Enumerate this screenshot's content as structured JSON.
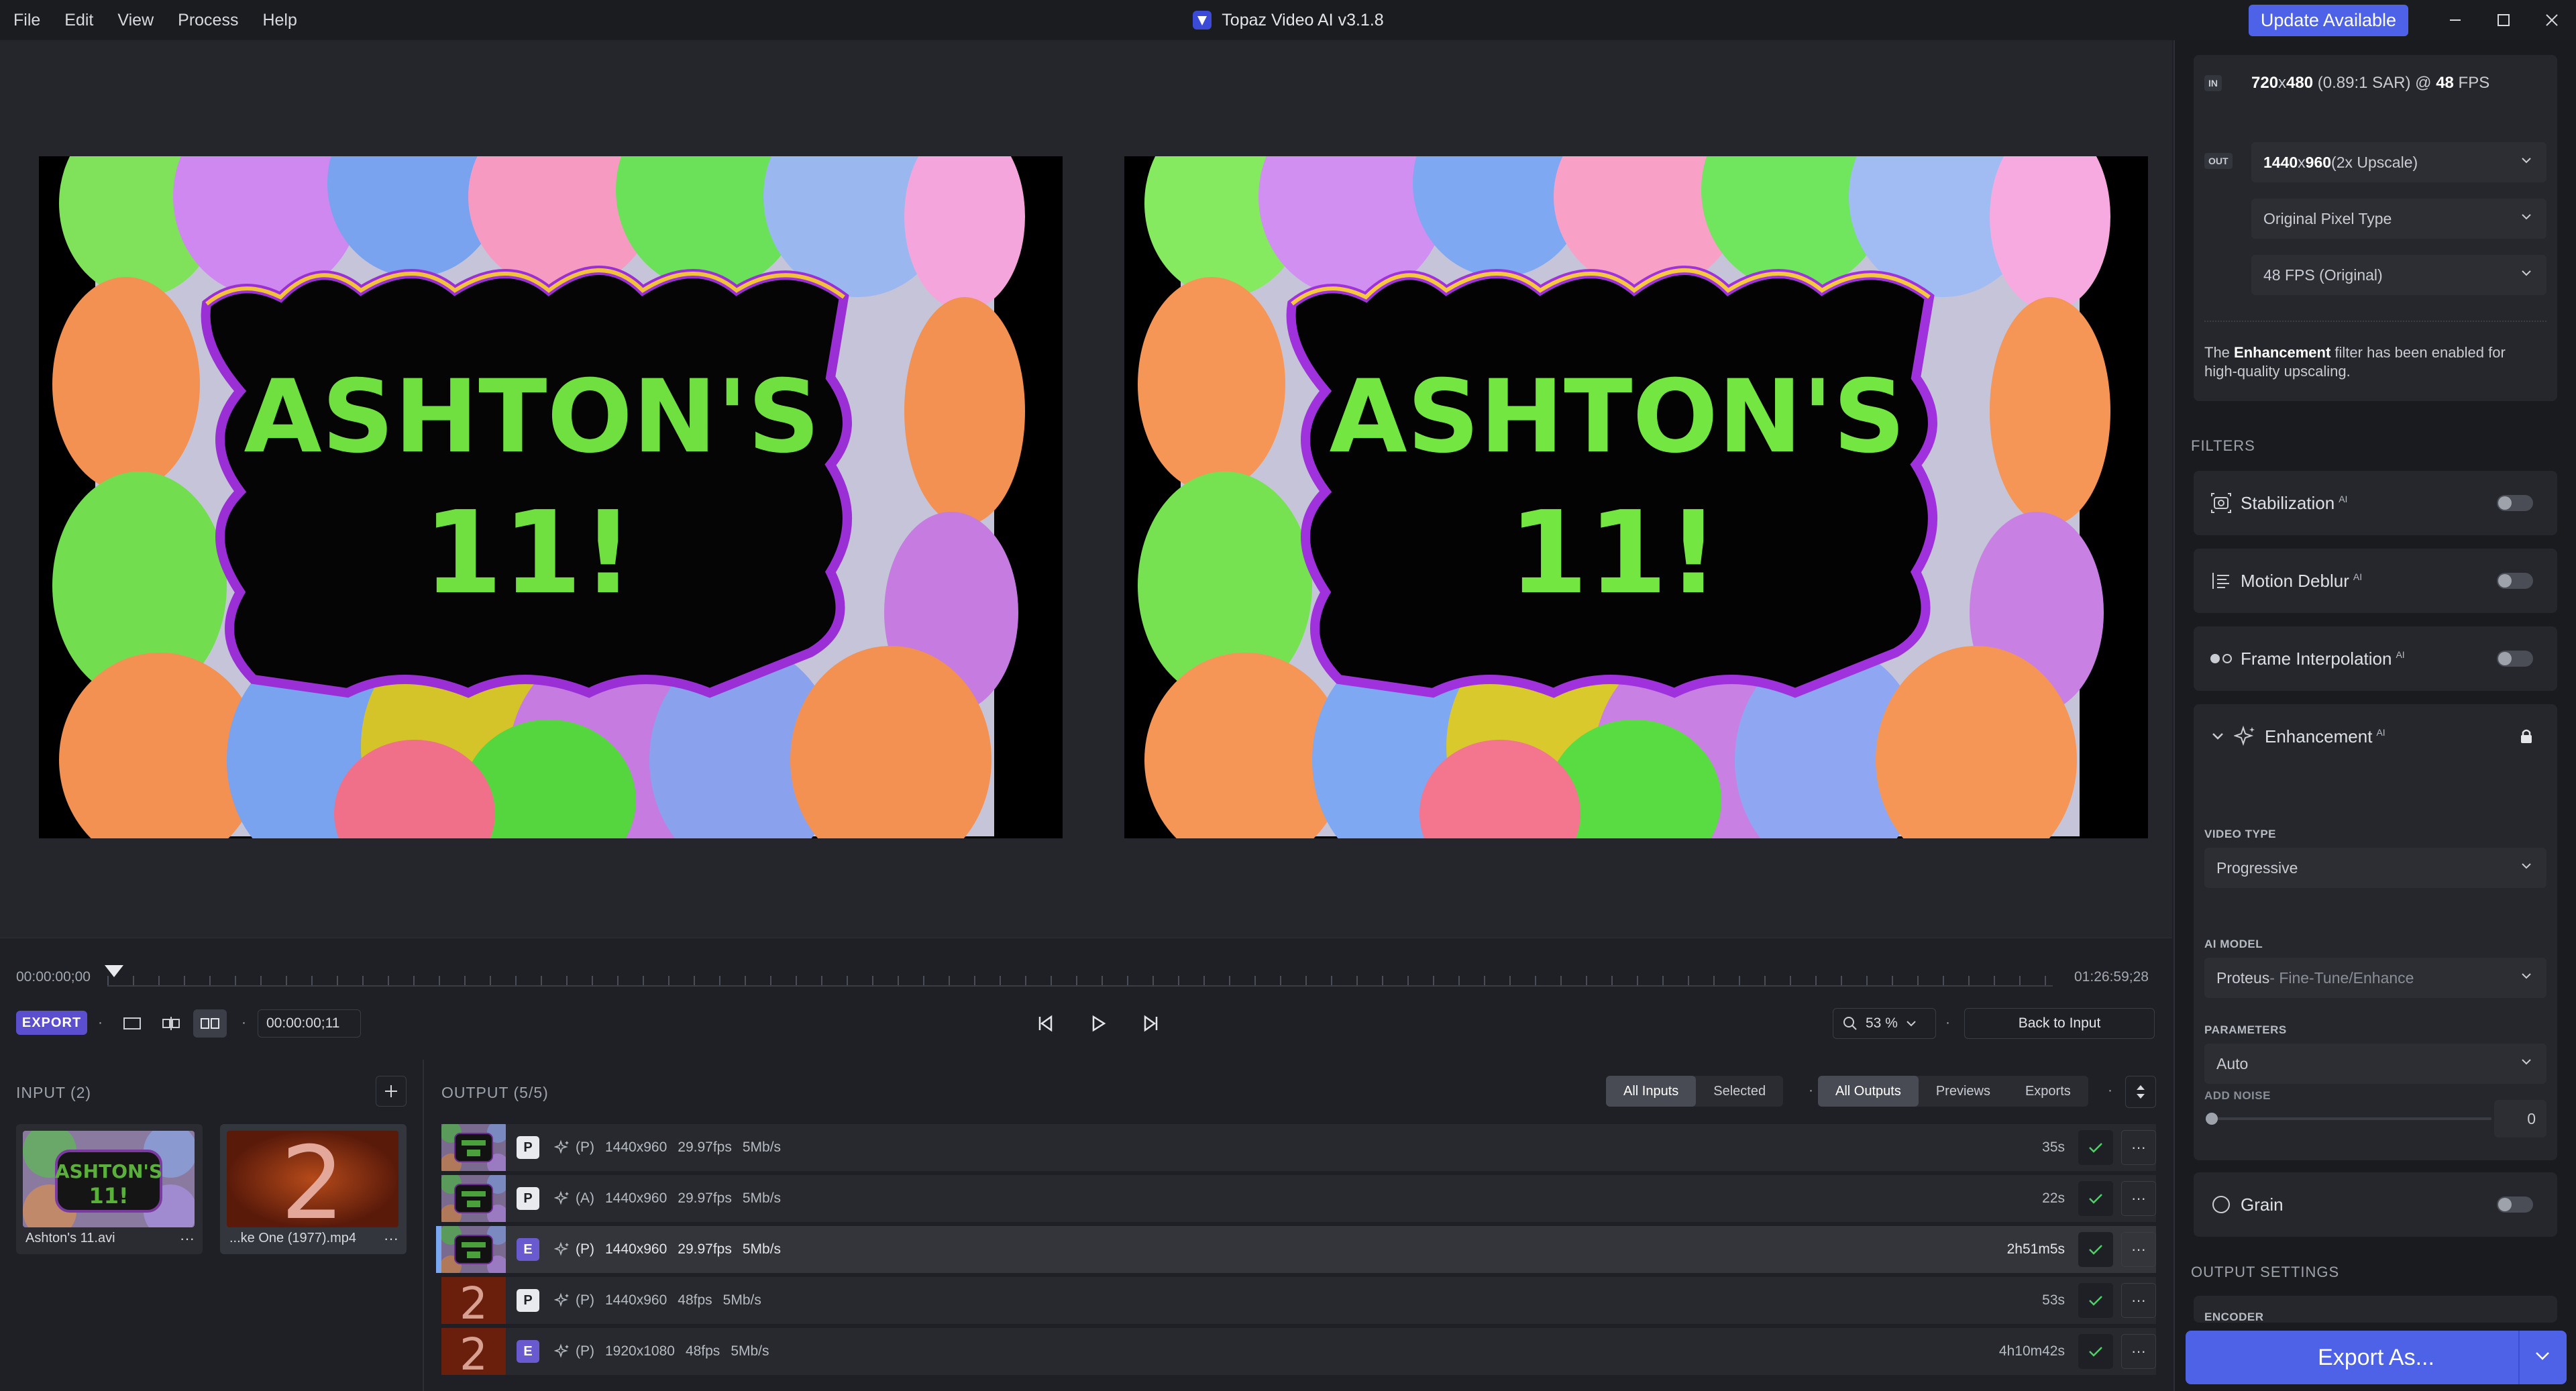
{
  "menu": [
    "File",
    "Edit",
    "View",
    "Process",
    "Help"
  ],
  "app_title": "Topaz Video AI  v3.1.8",
  "update_label": "Update Available",
  "preview_text": {
    "line1": "ASHTON'S",
    "line2": "11!"
  },
  "timeline": {
    "start_tc": "00:00:00;00",
    "end_tc": "01:26:59;28",
    "current_tc": "00:00:00;11",
    "export_label": "EXPORT",
    "zoom": "53 %",
    "back_to_input": "Back to Input"
  },
  "input_panel": {
    "title": "INPUT (2)",
    "items": [
      {
        "name": "Ashton's 11.avi",
        "more": "···"
      },
      {
        "name": "...ke One (1977).mp4",
        "more": "···",
        "thumb_text": "2"
      }
    ]
  },
  "output_panel": {
    "title": "OUTPUT (5/5)",
    "filters_left": [
      "All Inputs",
      "Selected"
    ],
    "filters_right": [
      "All Outputs",
      "Previews",
      "Exports"
    ],
    "rows": [
      {
        "tag": "P",
        "mode": "(P)",
        "res": "1440x960",
        "fps": "29.97fps",
        "bitrate": "5Mb/s",
        "duration": "35s",
        "thumb": "ashton"
      },
      {
        "tag": "P",
        "mode": "(A)",
        "res": "1440x960",
        "fps": "29.97fps",
        "bitrate": "5Mb/s",
        "duration": "22s",
        "thumb": "ashton"
      },
      {
        "tag": "E",
        "mode": "(P)",
        "res": "1440x960",
        "fps": "29.97fps",
        "bitrate": "5Mb/s",
        "duration": "2h51m5s",
        "thumb": "ashton"
      },
      {
        "tag": "P",
        "mode": "(P)",
        "res": "1440x960",
        "fps": "48fps",
        "bitrate": "5Mb/s",
        "duration": "53s",
        "thumb": "two"
      },
      {
        "tag": "E",
        "mode": "(P)",
        "res": "1920x1080",
        "fps": "48fps",
        "bitrate": "5Mb/s",
        "duration": "4h10m42s",
        "thumb": "two"
      }
    ],
    "more_label": "···"
  },
  "settings": {
    "in_tag": "IN",
    "out_tag": "OUT",
    "in_res": "720",
    "in_x": "x",
    "in_res2": "480",
    "in_sar": " (0.89:1 SAR) @ ",
    "in_fps": "48",
    "in_fps_unit": " FPS",
    "out_res_strong": "1440",
    "out_x": "x",
    "out_res2_strong": "960",
    "out_res_rest": " (2x Upscale)",
    "pixel_type": "Original Pixel Type",
    "fps_option": "48 FPS (Original)",
    "note_pre": "The ",
    "note_bold": "Enhancement",
    "note_post": " filter has been enabled for high-quality upscaling."
  },
  "filters": {
    "section_label": "FILTERS",
    "items": [
      {
        "name": "Stabilization",
        "ai": "AI"
      },
      {
        "name": "Motion Deblur",
        "ai": "AI"
      },
      {
        "name": "Frame Interpolation",
        "ai": "AI"
      }
    ],
    "enhancement": {
      "name": "Enhancement",
      "ai": "AI",
      "video_type_label": "VIDEO TYPE",
      "video_type": "Progressive",
      "ai_model_label": "AI MODEL",
      "ai_model_main": "Proteus",
      "ai_model_sub": " - Fine-Tune/Enhance",
      "parameters_label": "PARAMETERS",
      "parameters": "Auto",
      "add_noise_label": "ADD NOISE",
      "add_noise_value": "0"
    },
    "grain": {
      "name": "Grain"
    }
  },
  "output_settings_label": "OUTPUT SETTINGS",
  "encoder_label": "ENCODER",
  "export_as_label": "Export As...",
  "colors": {
    "accent": "#4e62e8",
    "export": "#5b4fd0",
    "e_tag": "#6a5ad0"
  }
}
